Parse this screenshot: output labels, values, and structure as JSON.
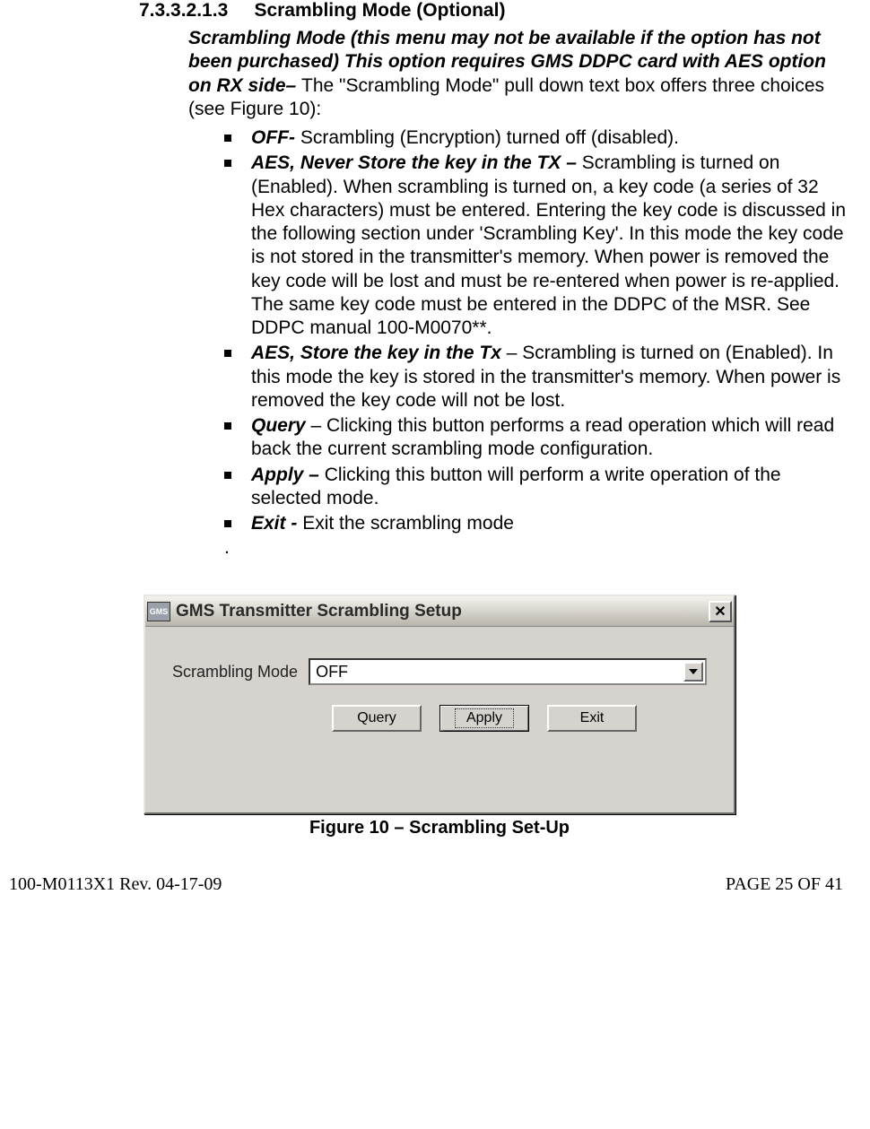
{
  "section": {
    "number": "7.3.3.2.1.3",
    "title": "Scrambling Mode (Optional)"
  },
  "intro": {
    "bi": "Scrambling Mode (this menu may not be available if the option has not been purchased) This option requires GMS DDPC card with AES option on RX side– ",
    "rest": "The \"Scrambling Mode\" pull down text box offers three choices (see Figure 10):"
  },
  "bullets": [
    {
      "bi": "OFF- ",
      "rest": "Scrambling (Encryption) turned off (disabled)."
    },
    {
      "bi": " AES, Never Store the key in the TX – ",
      "rest": "Scrambling is turned on (Enabled). When scrambling is turned on, a key code (a series of 32 Hex characters) must be entered. Entering the key code is discussed in the following section under 'Scrambling Key'. In this mode the key code is not stored in the transmitter's memory. When power is removed the key code will be lost and must be re-entered when power is re-applied. The same key code must be entered in the DDPC of the MSR. See DDPC manual 100-M0070**."
    },
    {
      "bi": "AES, Store the key in the Tx ",
      "rest": "– Scrambling is turned on (Enabled). In this mode the key is stored in the transmitter's memory. When power is removed the key code will not be lost."
    },
    {
      "bi": "Query ",
      "rest": "– Clicking this button performs a read operation which will read back the current scrambling mode configuration."
    },
    {
      "bi": "Apply – ",
      "rest": "Clicking this button will perform a write operation of the selected mode."
    },
    {
      "bi": "Exit - ",
      "rest": "Exit the scrambling mode"
    }
  ],
  "trail_dot": ".",
  "dialog": {
    "logo_text": "GMS",
    "title": "GMS Transmitter Scrambling Setup",
    "close_glyph": "✕",
    "label": "Scrambling Mode",
    "select_value": "OFF",
    "buttons": {
      "query": "Query",
      "apply": "Apply",
      "exit": "Exit"
    }
  },
  "figure_caption": "Figure 10 – Scrambling Set-Up",
  "footer": {
    "left": "100-M0113X1 Rev. 04-17-09",
    "right": "PAGE 25 OF 41"
  }
}
